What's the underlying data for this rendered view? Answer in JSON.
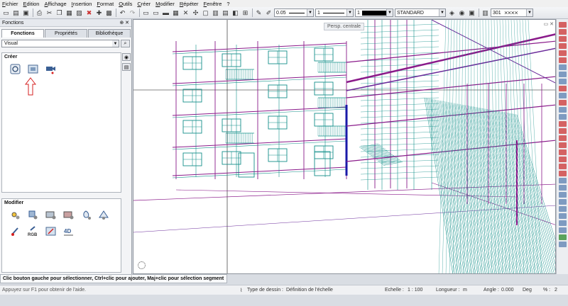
{
  "menu": [
    "Fichier",
    "Edition",
    "Affichage",
    "Insertion",
    "Format",
    "Outils",
    "Créer",
    "Modifier",
    "Répéter",
    "Fenêtre",
    "?"
  ],
  "toolbar": {
    "pen_thickness": "0.05",
    "line_type": "1",
    "color_index": "1",
    "style": "STANDARD",
    "hatch_number": "301"
  },
  "panel": {
    "title": "Fonctions",
    "pin": "⊕ ✕",
    "tabs": [
      "Fonctions",
      "Propriétés",
      "Bibliothèque"
    ],
    "active_tab": 0,
    "filter_value": "Visual",
    "create_label": "Créer",
    "modify_label": "Modifier"
  },
  "viewport": {
    "view_label": "Persp. centrale",
    "window_controls": "▭ ✕"
  },
  "hint_text": "Clic bouton gauche pour sélectionner, Ctrl+clic pour ajouter, Maj+clic pour sélection segment",
  "status": {
    "help": "Appuyez sur F1 pour obtenir de l'aide.",
    "drawing_type_label": "Type de dessin :",
    "drawing_type_value": "Définition de l'échelle",
    "scale_label": "Echelle :",
    "scale_value": "1 : 100",
    "length_label": "Longueur :",
    "length_unit": "m",
    "angle_label": "Angle :",
    "angle_value": "0.000",
    "angle_unit": "Deg",
    "percent_label": "% :",
    "percent_value": "2"
  },
  "colors": {
    "teal": "#14908a",
    "magenta": "#8a1a8a",
    "purple": "#6a2a9a",
    "accent_red": "#d62020"
  }
}
